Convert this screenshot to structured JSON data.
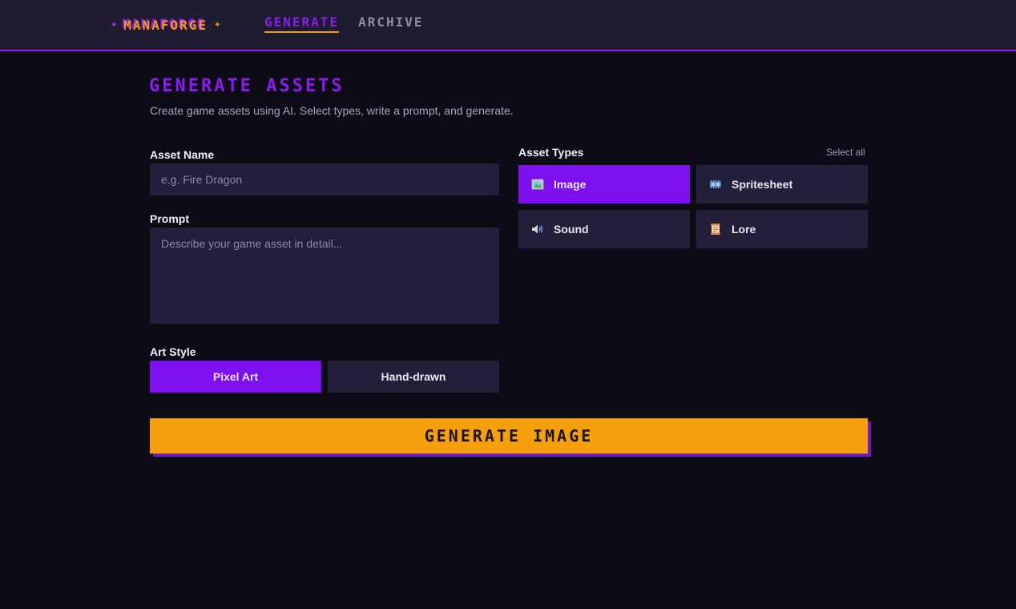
{
  "header": {
    "logo": "MANAFORGE",
    "nav": [
      {
        "label": "GENERATE",
        "active": true
      },
      {
        "label": "ARCHIVE",
        "active": false
      }
    ]
  },
  "main": {
    "title": "GENERATE ASSETS",
    "subtitle": "Create game assets using AI. Select types, write a prompt, and generate."
  },
  "form": {
    "asset_name": {
      "label": "Asset Name",
      "placeholder": "e.g. Fire Dragon",
      "value": ""
    },
    "prompt": {
      "label": "Prompt",
      "placeholder": "Describe your game asset in detail...",
      "value": ""
    },
    "art_style": {
      "label": "Art Style",
      "options": [
        {
          "label": "Pixel Art",
          "selected": true
        },
        {
          "label": "Hand-drawn",
          "selected": false
        }
      ]
    }
  },
  "asset_types": {
    "label": "Asset Types",
    "select_all": "Select all",
    "items": [
      {
        "label": "Image",
        "icon": "image-icon",
        "selected": true
      },
      {
        "label": "Spritesheet",
        "icon": "film-icon",
        "selected": false
      },
      {
        "label": "Sound",
        "icon": "speaker-icon",
        "selected": false
      },
      {
        "label": "Lore",
        "icon": "scroll-icon",
        "selected": false
      }
    ]
  },
  "generate_button": "GENERATE IMAGE",
  "colors": {
    "accent_purple": "#7e10f0",
    "accent_orange": "#f59f0c",
    "background": "#0d0c16",
    "panel": "#231f3a"
  }
}
